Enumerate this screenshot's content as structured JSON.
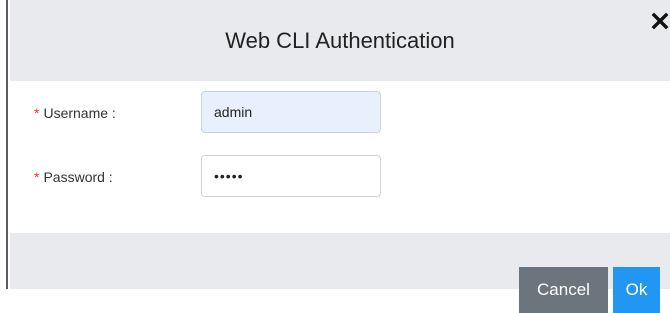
{
  "dialog": {
    "title": "Web CLI Authentication",
    "close_icon": "close-icon"
  },
  "form": {
    "username": {
      "required_marker": "*",
      "label": "Username :",
      "value": "admin"
    },
    "password": {
      "required_marker": "*",
      "label": "Password :",
      "value": "•••••"
    }
  },
  "footer": {
    "cancel_label": "Cancel",
    "ok_label": "Ok"
  },
  "colors": {
    "header_bg": "#e8eaed",
    "required": "#e53935",
    "cancel_bg": "#6c757d",
    "ok_bg": "#2196f3",
    "autofill_bg": "#e8f0fe"
  }
}
